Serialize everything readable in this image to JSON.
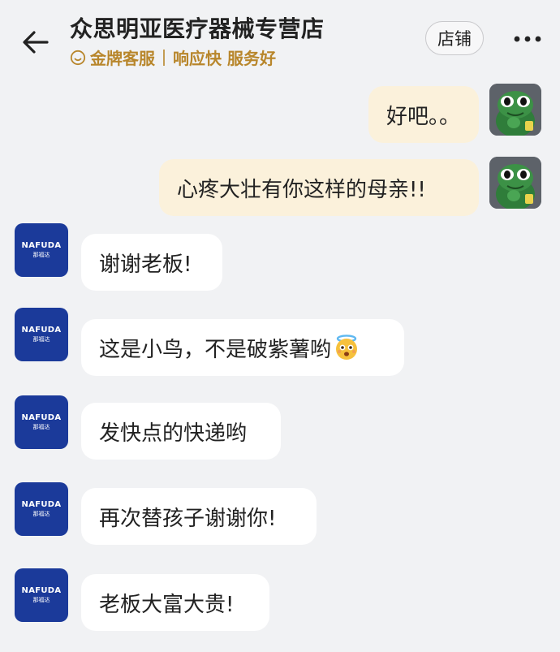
{
  "header": {
    "title": "众思明亚医疗器械专营店",
    "tags": [
      "金牌客服",
      "响应快 服务好"
    ],
    "store_button_label": "店铺"
  },
  "messages": [
    {
      "sender": "me",
      "text": "好吧。。"
    },
    {
      "sender": "me",
      "text": "心疼大壮有你这样的母亲!!"
    },
    {
      "sender": "store",
      "text": "谢谢老板!"
    },
    {
      "sender": "store",
      "text": "这是小鸟，不是破紫薯哟",
      "emoji": "halo-face-emoji"
    },
    {
      "sender": "store",
      "text": "发快点的快递哟"
    },
    {
      "sender": "store",
      "text": "再次替孩子谢谢你!"
    },
    {
      "sender": "store",
      "text": "老板大富大贵!"
    }
  ],
  "store_avatar": {
    "brand": "NAFUDA",
    "brand_cn": "那福达"
  },
  "colors": {
    "background": "#f1f2f4",
    "my_bubble": "#fbf1db",
    "their_bubble": "#ffffff",
    "gold_accent": "#b8862b",
    "store_avatar_blue": "#1b3a9a",
    "frog_green": "#2f7d3a"
  }
}
